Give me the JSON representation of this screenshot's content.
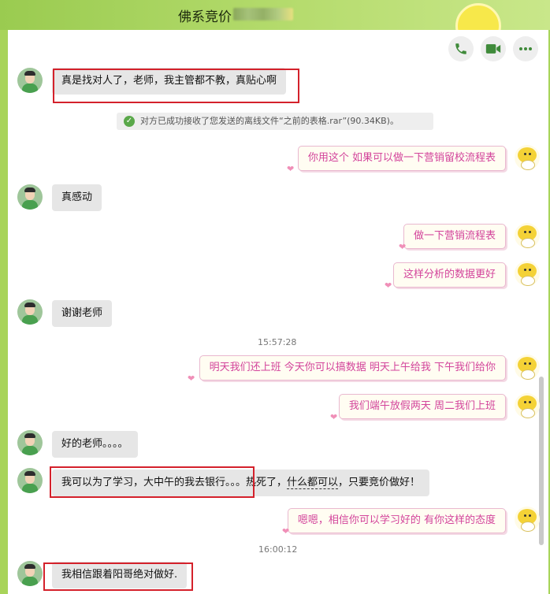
{
  "window": {
    "title": "佛系竞价"
  },
  "header": {
    "call_icon": "phone-icon",
    "video_icon": "video-camera-icon",
    "more_icon": "more-dots-icon"
  },
  "messages": {
    "m1": "真是找对人了，老师，我主管都不教，真贴心啊",
    "notice": "对方已成功接收了您发送的离线文件“之前的表格.rar”(90.34KB)。",
    "m2": "你用这个  如果可以做一下营销留校流程表",
    "m3": "真感动",
    "m4": "做一下营销流程表",
    "m5": "这样分析的数据更好",
    "m6": "谢谢老师",
    "t1": "15:57:28",
    "m7": "明天我们还上班 今天你可以搞数据  明天上午给我 下午我们给你",
    "m8": "我们端午放假两天  周二我们上班",
    "m9": "好的老师。。。。",
    "m10_a": "我可以为了学习，大中午的我去银行。。。热死了，",
    "m10_b": "什么都可以",
    "m10_c": "，只要竞价做好！",
    "m11": "嗯嗯，相信你可以学习好的 有你这样的态度",
    "t2": "16:00:12",
    "m12": "我相信跟着阳哥绝对做好."
  },
  "colors": {
    "header_green": "#a8d45a",
    "incoming_bubble": "#e6e6e6",
    "outgoing_text": "#d3449b",
    "highlight_box": "#d4212b"
  }
}
